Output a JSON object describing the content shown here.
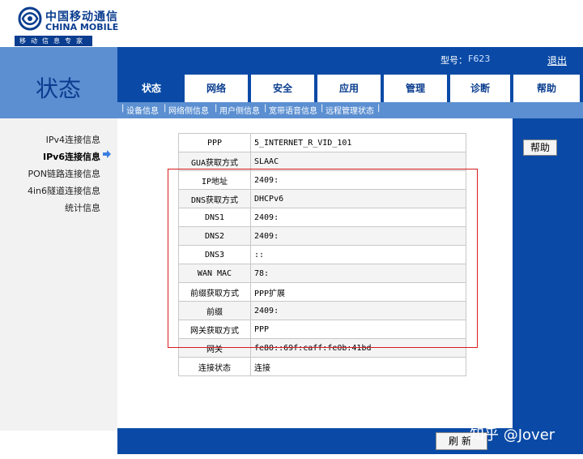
{
  "brand": {
    "name_cn": "中国移动通信",
    "name_en": "CHINA MOBILE",
    "slogan": "移动信息专家"
  },
  "page_title": "状态",
  "header": {
    "model_label": "型号：",
    "model_value": "F623",
    "logout": "退出"
  },
  "menu": [
    {
      "label": "状态",
      "active": true
    },
    {
      "label": "网络",
      "active": false
    },
    {
      "label": "安全",
      "active": false
    },
    {
      "label": "应用",
      "active": false
    },
    {
      "label": "管理",
      "active": false
    },
    {
      "label": "诊断",
      "active": false
    },
    {
      "label": "帮助",
      "active": false
    }
  ],
  "submenu": [
    {
      "label": "设备信息"
    },
    {
      "label": "网络侧信息"
    },
    {
      "label": "用户侧信息"
    },
    {
      "label": "宽带语音信息"
    },
    {
      "label": "远程管理状态"
    }
  ],
  "left_nav": [
    {
      "label": "IPv4连接信息"
    },
    {
      "label": "IPv6连接信息"
    },
    {
      "label": "PON链路连接信息"
    },
    {
      "label": "4in6隧道连接信息"
    },
    {
      "label": "统计信息"
    }
  ],
  "help_button": "帮助",
  "refresh_button": "刷新",
  "watermark": "知乎 @Jover",
  "table_rows": [
    {
      "key": "PPP",
      "value": "5_INTERNET_R_VID_101"
    },
    {
      "key": "GUA获取方式",
      "value": "SLAAC"
    },
    {
      "key": "IP地址",
      "value": "2409:"
    },
    {
      "key": "DNS获取方式",
      "value": "DHCPv6"
    },
    {
      "key": "DNS1",
      "value": "2409:"
    },
    {
      "key": "DNS2",
      "value": "2409:"
    },
    {
      "key": "DNS3",
      "value": "::"
    },
    {
      "key": "WAN MAC",
      "value": "78:"
    },
    {
      "key": "前缀获取方式",
      "value": "PPP扩展"
    },
    {
      "key": "前缀",
      "value": "2409:"
    },
    {
      "key": "网关获取方式",
      "value": "PPP"
    },
    {
      "key": "网关",
      "value": "fe80::69f:caff:fe0b:41bd"
    },
    {
      "key": "连接状态",
      "value": "连接"
    }
  ],
  "colors": {
    "brand_blue": "#0a4aa6",
    "light_blue": "#5b8fd1",
    "highlight_red": "#d81c1c"
  }
}
